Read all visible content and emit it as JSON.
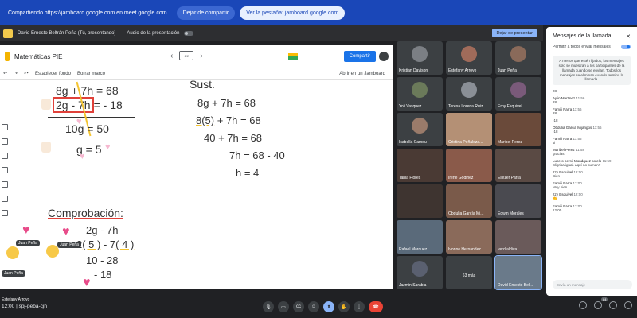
{
  "share_bar": {
    "message": "Compartiendo https://jamboard.google.com en meet.google.com",
    "stop_label": "Dejar de compartir",
    "go_label": "Ver la pestaña: jamboard.google.com"
  },
  "presenter_bar": {
    "presenter": "David Ernesto Beltrán Peña (Tú, presentando)",
    "audio": "Audio de la presentación",
    "stop_presenting": "Dejar de presentar"
  },
  "jamboard": {
    "title": "Matemáticas PIE",
    "frame_label": "2/2",
    "share": "Compartir",
    "set_background": "Establecer fondo",
    "clear_frame": "Borrar marco",
    "open_in": "Abrir en un Jamboard",
    "left_work": {
      "line1": "8g + 7h =   68",
      "line2_box": "2g  - 7h",
      "line2_rest": "= - 18",
      "line3": "10g   = 50",
      "line4": "g = 5"
    },
    "right_work": {
      "header": "Sust.",
      "l1": "8g + 7h = 68",
      "l2a": "8(5)",
      "l2b": " + 7h = 68",
      "l3": "40 + 7h = 68",
      "l4": "7h = 68 - 40",
      "l5": "h = 4"
    },
    "check": {
      "title": "Comprobación:",
      "c1": "2g - 7h",
      "c2a": "2",
      "c2b": "( 5 )",
      "c2c": " - 7",
      "c2d": "( 4 )",
      "c3": "10 - 28",
      "c4": "- 18"
    },
    "reaction_names": [
      "Juan Peña",
      "Juan Peña",
      "Juan Peña"
    ]
  },
  "participants": [
    {
      "name": "Kristian Davison",
      "color": "#7b7f84"
    },
    {
      "name": "Estefany Arroyo",
      "color": "#a06b5a"
    },
    {
      "name": "Juan Peña",
      "color": "#8a6a5a"
    },
    {
      "name": "Yoli Vasquez",
      "color": "#6b7a5a"
    },
    {
      "name": "Teresa Lorena Ruiz",
      "color": "#8a8f96"
    },
    {
      "name": "Erny Esquivel",
      "color": "#7a5a7a"
    },
    {
      "name": "Isabella Camou",
      "color": "#9a7b6a"
    },
    {
      "name": "Cristina Peñaloza...",
      "color": "#b49075"
    },
    {
      "name": "Maribel Perez",
      "color": "#6a4a3a"
    },
    {
      "name": "Tania Flores",
      "color": "#4a3a34"
    },
    {
      "name": "Irene Godinez",
      "color": "#8a5a4a"
    },
    {
      "name": "Eliezer Parra",
      "color": "#5a4a44"
    },
    {
      "name": "",
      "color": "#3e3430"
    },
    {
      "name": "Obdulia García Mi...",
      "color": "#7a5a4a"
    },
    {
      "name": "Edwin Morales",
      "color": "#4a4a50"
    },
    {
      "name": "Rafael Marquez",
      "color": "#5a6a7a"
    },
    {
      "name": "Ivonne Hernandez",
      "color": "#8a6a5a"
    },
    {
      "name": "verd aldiva",
      "color": "#6a5a5a"
    },
    {
      "name": "Jazmin Sarabia",
      "color": "#5a6070"
    },
    {
      "name": "63 más",
      "color": "#3c4043"
    },
    {
      "name": "David Ernesto Bel...",
      "color": "#6a7a8a"
    }
  ],
  "chat": {
    "title": "Mensajes de la llamada",
    "allow": "Permitir a todos enviar mensajes",
    "note": "A menos que estén fijados, los mensajes solo se muestran a los participantes de la llamada cuando se envían. Todos los mensajes se eliminan cuando termina la llamada.",
    "messages": [
      {
        "who": "",
        "time": "",
        "text": "28"
      },
      {
        "who": "Aylin Martinez",
        "time": "11:56",
        "text": "28"
      },
      {
        "who": "Famili Parra",
        "time": "11:56",
        "text": "28"
      },
      {
        "who": "",
        "time": "",
        "text": "-18"
      },
      {
        "who": "Obdulia Garcia Mijangos",
        "time": "11:56",
        "text": "-18"
      },
      {
        "who": "Famili Parra",
        "time": "11:56",
        "text": "si"
      },
      {
        "who": "Maribel Perez",
        "time": "11:58",
        "text": "gracias"
      },
      {
        "who": "Lucero persil Mondquez sotelo",
        "time": "11:59",
        "text": "Sligrisa igual. aquí no suman?"
      },
      {
        "who": "Itzy Esquivel",
        "time": "12:00",
        "text": "Bien"
      },
      {
        "who": "Famili Parra",
        "time": "12:00",
        "text": "Muy bien"
      },
      {
        "who": "Itzy Esquivel",
        "time": "12:00",
        "text": "👏"
      },
      {
        "who": "Famili Parra",
        "time": "12:00",
        "text": "12:00"
      }
    ],
    "input_placeholder": "Envía un mensaje"
  },
  "bottom": {
    "meeting_code": "12:00  |  spj-peba-cjh",
    "bottom_name": "Estefany Arroyo",
    "people_count": "84"
  }
}
